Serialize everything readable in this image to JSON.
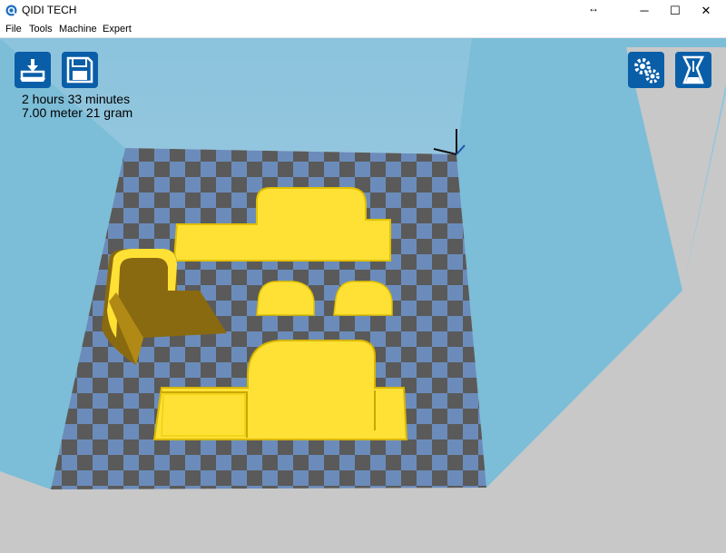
{
  "titlebar": {
    "title": "QIDI TECH",
    "resize_glyph": "↔",
    "minimize": "─",
    "maximize": "☐",
    "close": "✕"
  },
  "menu": {
    "file": "File",
    "tools": "Tools",
    "machine": "Machine",
    "expert": "Expert"
  },
  "toolbar": {
    "left_buttons": [
      "load-model-icon",
      "save-floppy-icon"
    ],
    "right_buttons": [
      "settings-gears-icon",
      "expert-mode-icon"
    ],
    "accent_color": "#0a5ea8"
  },
  "print_info": {
    "time": "2 hours 33 minutes",
    "material": "7.00 meter 21 gram"
  },
  "scene": {
    "model_color": "#ffe135",
    "bed_color_light": "#6b8cbb",
    "bed_color_dark": "#5a5a5a",
    "wall_color": "#7cbdd8",
    "floor_color": "#c8c8c8"
  }
}
